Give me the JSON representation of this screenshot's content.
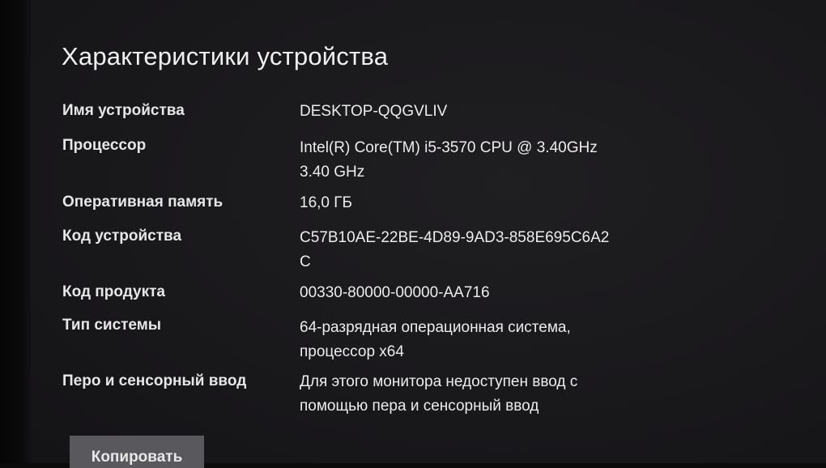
{
  "section": {
    "title": "Характеристики устройства"
  },
  "specs": [
    {
      "label": "Имя устройства",
      "value_lines": [
        "DESKTOP-QQGVLIV"
      ]
    },
    {
      "label": "Процессор",
      "value_lines": [
        "Intel(R) Core(TM) i5-3570 CPU @ 3.40GHz",
        "3.40 GHz"
      ]
    },
    {
      "label": "Оперативная память",
      "value_lines": [
        "16,0 ГБ"
      ]
    },
    {
      "label": "Код устройства",
      "value_lines": [
        "C57B10AE-22BE-4D89-9AD3-858E695C6A2",
        "C"
      ]
    },
    {
      "label": "Код продукта",
      "value_lines": [
        "00330-80000-00000-AA716"
      ]
    },
    {
      "label": "Тип системы",
      "value_lines": [
        "64-разрядная операционная система,",
        "процессор x64"
      ]
    },
    {
      "label": "Перо и сенсорный ввод",
      "value_lines": [
        "Для этого монитора недоступен ввод с",
        "помощью пера и сенсорный ввод"
      ]
    }
  ],
  "actions": {
    "copy_label": "Копировать"
  }
}
